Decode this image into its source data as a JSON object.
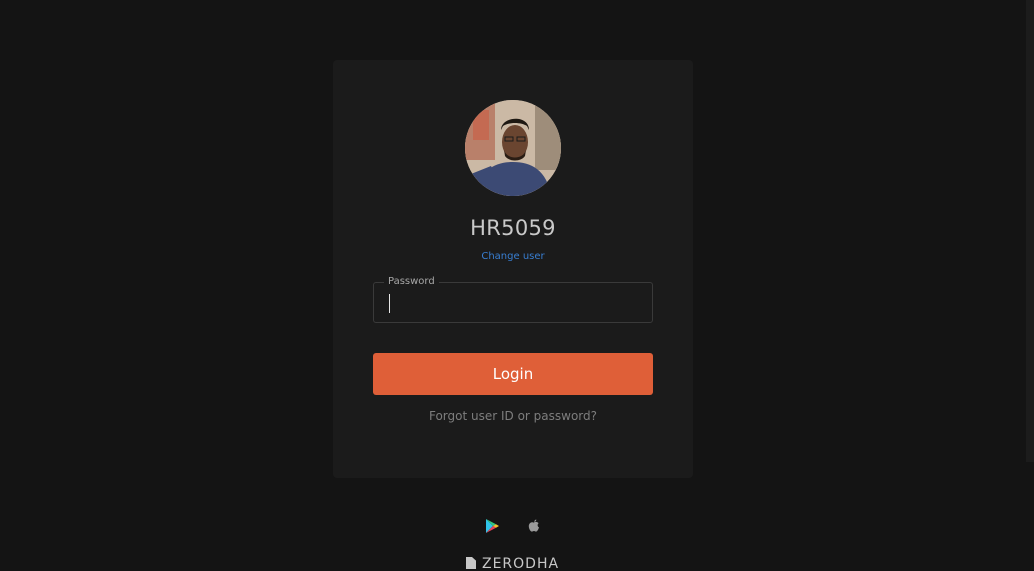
{
  "profile": {
    "user_id": "HR5059",
    "change_user_label": "Change user"
  },
  "password_field": {
    "label": "Password",
    "value": "",
    "placeholder": ""
  },
  "login_button": {
    "label": "Login"
  },
  "forgot_link": {
    "label": "Forgot user ID or password?"
  },
  "app_links": {
    "icons": [
      "google-play-icon",
      "apple-icon"
    ]
  },
  "brand": {
    "name": "ZERODHA",
    "logo_icon": "zerodha-logo-icon"
  },
  "colors": {
    "background": "#141414",
    "card": "#1b1b1b",
    "accent_login": "#df5f38",
    "link_blue": "#387ed1"
  }
}
